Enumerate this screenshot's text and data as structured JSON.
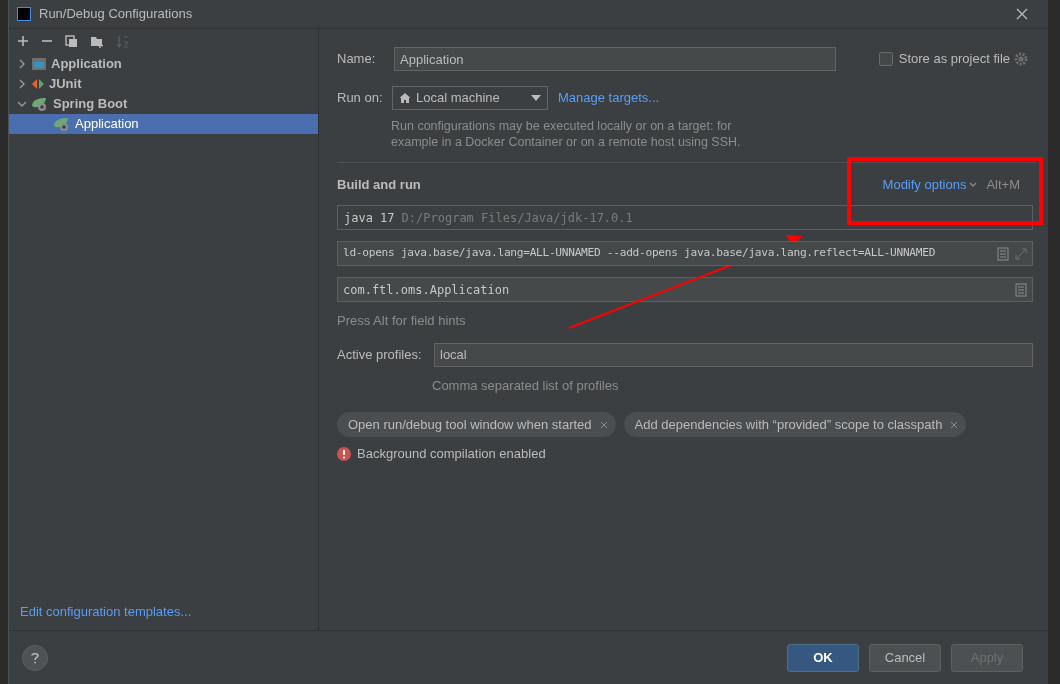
{
  "window": {
    "title": "Run/Debug Configurations"
  },
  "tree": [
    {
      "label": "Application",
      "kind": "application",
      "expanded": false,
      "selected": false
    },
    {
      "label": "JUnit",
      "kind": "junit",
      "expanded": false,
      "selected": false
    },
    {
      "label": "Spring Boot",
      "kind": "spring",
      "expanded": true,
      "selected": false,
      "children": [
        {
          "label": "Application",
          "kind": "spring",
          "selected": true
        }
      ]
    }
  ],
  "edit_templates_link": "Edit configuration templates...",
  "name_field": {
    "label": "Name:",
    "value": "Application"
  },
  "store_as_project_file": {
    "label": "Store as project file",
    "checked": false
  },
  "run_on": {
    "label": "Run on:",
    "value": "Local machine",
    "link": "Manage targets...",
    "hint": "Run configurations may be executed locally or on a target: for example in a Docker Container or on a remote host using SSH."
  },
  "build_and_run": {
    "title": "Build and run",
    "modify_options": "Modify options",
    "shortcut": "Alt+M",
    "jdk": {
      "name": "java 17",
      "path": "D:/Program Files/Java/jdk-17.0.1"
    },
    "vm_options": "ld-opens java.base/java.lang=ALL-UNNAMED --add-opens java.base/java.lang.reflect=ALL-UNNAMED",
    "main_class": "com.ftl.oms.Application",
    "field_hint": "Press Alt for field hints"
  },
  "active_profiles": {
    "label": "Active profiles:",
    "value": "local",
    "hint": "Comma separated list of profiles"
  },
  "chips": [
    "Open run/debug tool window when started",
    "Add dependencies with “provided” scope to classpath"
  ],
  "warning": "Background compilation enabled",
  "buttons": [
    {
      "label": "OK",
      "default": true,
      "disabled": false
    },
    {
      "label": "Cancel",
      "default": false,
      "disabled": false
    },
    {
      "label": "Apply",
      "default": false,
      "disabled": true
    }
  ]
}
